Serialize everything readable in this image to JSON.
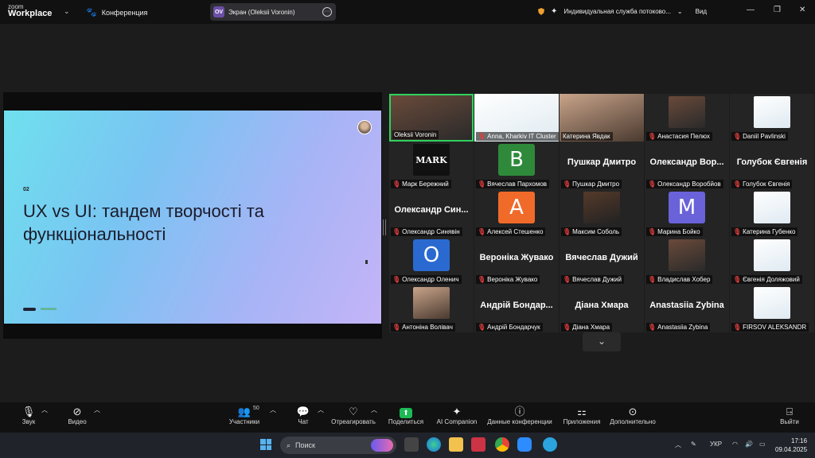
{
  "titlebar": {
    "logo_line1": "zoom",
    "logo_line2": "Workplace",
    "meeting_label": "Конференция",
    "screen_avatar": "OV",
    "screen_label": "Экран (Oleksii Voronin)",
    "service_label": "Индивидуальная служба потоково...",
    "view_label": "Вид"
  },
  "slide": {
    "number": "02",
    "title": "UX vs UI: тандем творчості та функціональності"
  },
  "gallery": {
    "tiles": [
      {
        "label": "Oleksii Voronin",
        "mic_off": false,
        "kind": "video"
      },
      {
        "label": "Anna, Kharkiv IT Cluster",
        "mic_off": true,
        "kind": "video"
      },
      {
        "label": "Катерина Явдак",
        "mic_off": false,
        "kind": "video"
      },
      {
        "label": "Анастасия Пелюх",
        "mic_off": true,
        "kind": "photo"
      },
      {
        "label": "Daniil Pavlinski",
        "mic_off": true,
        "kind": "photo"
      },
      {
        "label": "Марк Бережний",
        "mic_off": true,
        "kind": "photo",
        "photo_text": "MARK"
      },
      {
        "label": "Вячеслав Пархомов",
        "mic_off": true,
        "kind": "letter",
        "letter": "В",
        "color": "#2e8a3a"
      },
      {
        "label": "Пушкар Дмитро",
        "mic_off": true,
        "kind": "name",
        "name": "Пушкар Дмитро"
      },
      {
        "label": "Олександр Воробйов",
        "mic_off": true,
        "kind": "name",
        "name": "Олександр Вор..."
      },
      {
        "label": "Голубок Євгенія",
        "mic_off": true,
        "kind": "name",
        "name": "Голубок Євгенія"
      },
      {
        "label": "Олександр Синявін",
        "mic_off": true,
        "kind": "name",
        "name": "Олександр Син..."
      },
      {
        "label": "Алексей Стешенко",
        "mic_off": true,
        "kind": "letter",
        "letter": "А",
        "color": "#f06a2a"
      },
      {
        "label": "Максим Соболь",
        "mic_off": true,
        "kind": "photo"
      },
      {
        "label": "Марина Бойко",
        "mic_off": true,
        "kind": "letter",
        "letter": "М",
        "color": "#6a62d8"
      },
      {
        "label": "Катерина Губенко",
        "mic_off": true,
        "kind": "photo"
      },
      {
        "label": "Олександр Оленич",
        "mic_off": true,
        "kind": "letter",
        "letter": "О",
        "color": "#2a6ad0"
      },
      {
        "label": "Вероніка Жувако",
        "mic_off": true,
        "kind": "name",
        "name": "Вероніка Жувако"
      },
      {
        "label": "Вячеслав Дужий",
        "mic_off": true,
        "kind": "name",
        "name": "Вячеслав Дужий"
      },
      {
        "label": "Владислав Хобер",
        "mic_off": true,
        "kind": "photo"
      },
      {
        "label": "Євгенія Доляжовий",
        "mic_off": true,
        "kind": "photo"
      },
      {
        "label": "Антоніна Волівач",
        "mic_off": true,
        "kind": "photo"
      },
      {
        "label": "Андрій Бондарчук",
        "mic_off": true,
        "kind": "name",
        "name": "Андрій Бондар..."
      },
      {
        "label": "Діана Хмара",
        "mic_off": true,
        "kind": "name",
        "name": "Діана Хмара"
      },
      {
        "label": "Anastasiia Zybina",
        "mic_off": true,
        "kind": "name",
        "name": "Anastasiia Zybina"
      },
      {
        "label": "FIRSOV ALEKSANDR",
        "mic_off": true,
        "kind": "photo"
      }
    ]
  },
  "toolbar": {
    "audio": "Звук",
    "video": "Видео",
    "participants": "Участники",
    "participants_count": "50",
    "chat": "Чат",
    "react": "Отреагировать",
    "share": "Поделиться",
    "ai": "AI Companion",
    "info": "Данные конференции",
    "apps": "Приложения",
    "more": "Дополнительно",
    "leave": "Выйти"
  },
  "taskbar": {
    "search": "Поиск",
    "lang": "УКР",
    "time": "17:16",
    "date": "09.04.2025"
  }
}
